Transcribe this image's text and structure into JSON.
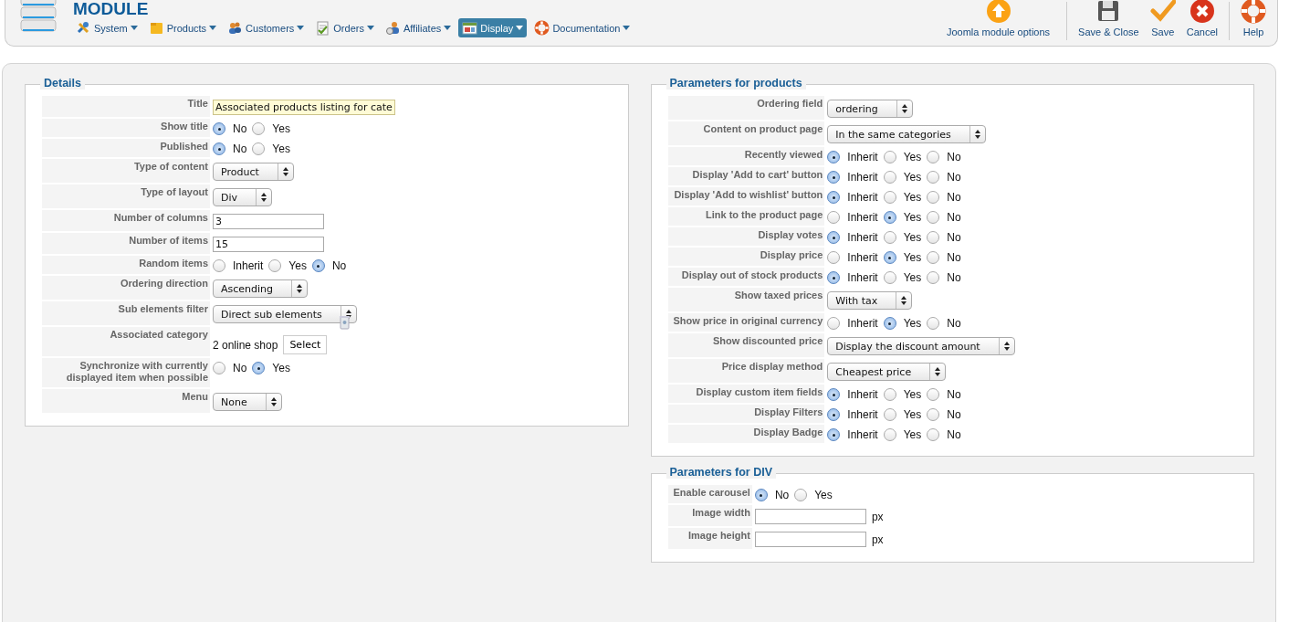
{
  "header": {
    "title": "MODULE",
    "menu": [
      {
        "label": "System",
        "selected": false
      },
      {
        "label": "Products",
        "selected": false
      },
      {
        "label": "Customers",
        "selected": false
      },
      {
        "label": "Orders",
        "selected": false
      },
      {
        "label": "Affiliates",
        "selected": false
      },
      {
        "label": "Display",
        "selected": true
      },
      {
        "label": "Documentation",
        "selected": false
      }
    ],
    "toolbar": [
      [
        {
          "label": "Joomla module options"
        }
      ],
      [
        {
          "label": "Save & Close"
        },
        {
          "label": "Save"
        },
        {
          "label": "Cancel"
        }
      ],
      [
        {
          "label": "Help"
        }
      ]
    ]
  },
  "columns": [
    [
      {
        "title": "Details",
        "fields": [
          {
            "kind": "text",
            "label": "Title",
            "value": "Associated products listing for cate",
            "focused": true
          },
          {
            "kind": "radio",
            "label": "Show title",
            "options": [
              {
                "label": "No",
                "selected": true
              },
              {
                "label": "Yes",
                "selected": false
              }
            ]
          },
          {
            "kind": "radio",
            "label": "Published",
            "options": [
              {
                "label": "No",
                "selected": true
              },
              {
                "label": "Yes",
                "selected": false
              }
            ]
          },
          {
            "kind": "select",
            "label": "Type of content",
            "value": "Product"
          },
          {
            "kind": "select",
            "label": "Type of layout",
            "value": "Div"
          },
          {
            "kind": "text",
            "label": "Number of columns",
            "value": "3",
            "focused": false
          },
          {
            "kind": "text",
            "label": "Number of items",
            "value": "15",
            "focused": false
          },
          {
            "kind": "radio",
            "label": "Random items",
            "options": [
              {
                "label": "Inherit",
                "selected": false
              },
              {
                "label": "Yes",
                "selected": false
              },
              {
                "label": "No",
                "selected": true
              }
            ]
          },
          {
            "kind": "select",
            "label": "Ordering direction",
            "value": "Ascending"
          },
          {
            "kind": "select",
            "label": "Sub elements filter",
            "value": "Direct sub elements"
          },
          {
            "kind": "category",
            "label": "Associated category",
            "value": "2 online shop",
            "button": "Select"
          },
          {
            "kind": "radio",
            "label": "Synchronize with currently displayed item when possible",
            "options": [
              {
                "label": "No",
                "selected": false
              },
              {
                "label": "Yes",
                "selected": true
              }
            ]
          },
          {
            "kind": "select",
            "label": "Menu",
            "value": "None"
          }
        ]
      }
    ],
    [
      {
        "title": "Parameters for products",
        "fields": [
          {
            "kind": "select",
            "label": "Ordering field",
            "value": "ordering"
          },
          {
            "kind": "select",
            "label": "Content on product page",
            "value": "In the same categories"
          },
          {
            "kind": "radio",
            "label": "Recently viewed",
            "options": [
              {
                "label": "Inherit",
                "selected": true
              },
              {
                "label": "Yes",
                "selected": false
              },
              {
                "label": "No",
                "selected": false
              }
            ]
          },
          {
            "kind": "radio",
            "label": "Display 'Add to cart' button",
            "options": [
              {
                "label": "Inherit",
                "selected": true
              },
              {
                "label": "Yes",
                "selected": false
              },
              {
                "label": "No",
                "selected": false
              }
            ]
          },
          {
            "kind": "radio",
            "label": "Display 'Add to wishlist' button",
            "options": [
              {
                "label": "Inherit",
                "selected": true
              },
              {
                "label": "Yes",
                "selected": false
              },
              {
                "label": "No",
                "selected": false
              }
            ]
          },
          {
            "kind": "radio",
            "label": "Link to the product page",
            "options": [
              {
                "label": "Inherit",
                "selected": false
              },
              {
                "label": "Yes",
                "selected": true
              },
              {
                "label": "No",
                "selected": false
              }
            ]
          },
          {
            "kind": "radio",
            "label": "Display votes",
            "options": [
              {
                "label": "Inherit",
                "selected": true
              },
              {
                "label": "Yes",
                "selected": false
              },
              {
                "label": "No",
                "selected": false
              }
            ]
          },
          {
            "kind": "radio",
            "label": "Display price",
            "options": [
              {
                "label": "Inherit",
                "selected": false
              },
              {
                "label": "Yes",
                "selected": true
              },
              {
                "label": "No",
                "selected": false
              }
            ]
          },
          {
            "kind": "radio",
            "label": "Display out of stock products",
            "options": [
              {
                "label": "Inherit",
                "selected": true
              },
              {
                "label": "Yes",
                "selected": false
              },
              {
                "label": "No",
                "selected": false
              }
            ]
          },
          {
            "kind": "select",
            "label": "Show taxed prices",
            "value": "With tax"
          },
          {
            "kind": "radio",
            "label": "Show price in original currency",
            "options": [
              {
                "label": "Inherit",
                "selected": false
              },
              {
                "label": "Yes",
                "selected": true
              },
              {
                "label": "No",
                "selected": false
              }
            ]
          },
          {
            "kind": "select",
            "label": "Show discounted price",
            "value": "Display the discount amount"
          },
          {
            "kind": "select",
            "label": "Price display method",
            "value": "Cheapest price"
          },
          {
            "kind": "radio",
            "label": "Display custom item fields",
            "options": [
              {
                "label": "Inherit",
                "selected": true
              },
              {
                "label": "Yes",
                "selected": false
              },
              {
                "label": "No",
                "selected": false
              }
            ]
          },
          {
            "kind": "radio",
            "label": "Display Filters",
            "options": [
              {
                "label": "Inherit",
                "selected": true
              },
              {
                "label": "Yes",
                "selected": false
              },
              {
                "label": "No",
                "selected": false
              }
            ]
          },
          {
            "kind": "radio",
            "label": "Display Badge",
            "options": [
              {
                "label": "Inherit",
                "selected": true
              },
              {
                "label": "Yes",
                "selected": false
              },
              {
                "label": "No",
                "selected": false
              }
            ]
          }
        ]
      },
      {
        "title": "Parameters for DIV",
        "fields": [
          {
            "kind": "radio",
            "label": "Enable carousel",
            "options": [
              {
                "label": "No",
                "selected": true
              },
              {
                "label": "Yes",
                "selected": false
              }
            ]
          },
          {
            "kind": "text",
            "label": "Image width",
            "unit": "px",
            "focused": false
          },
          {
            "kind": "text",
            "label": "Image height",
            "unit": "px",
            "focused": false
          }
        ]
      }
    ]
  ]
}
